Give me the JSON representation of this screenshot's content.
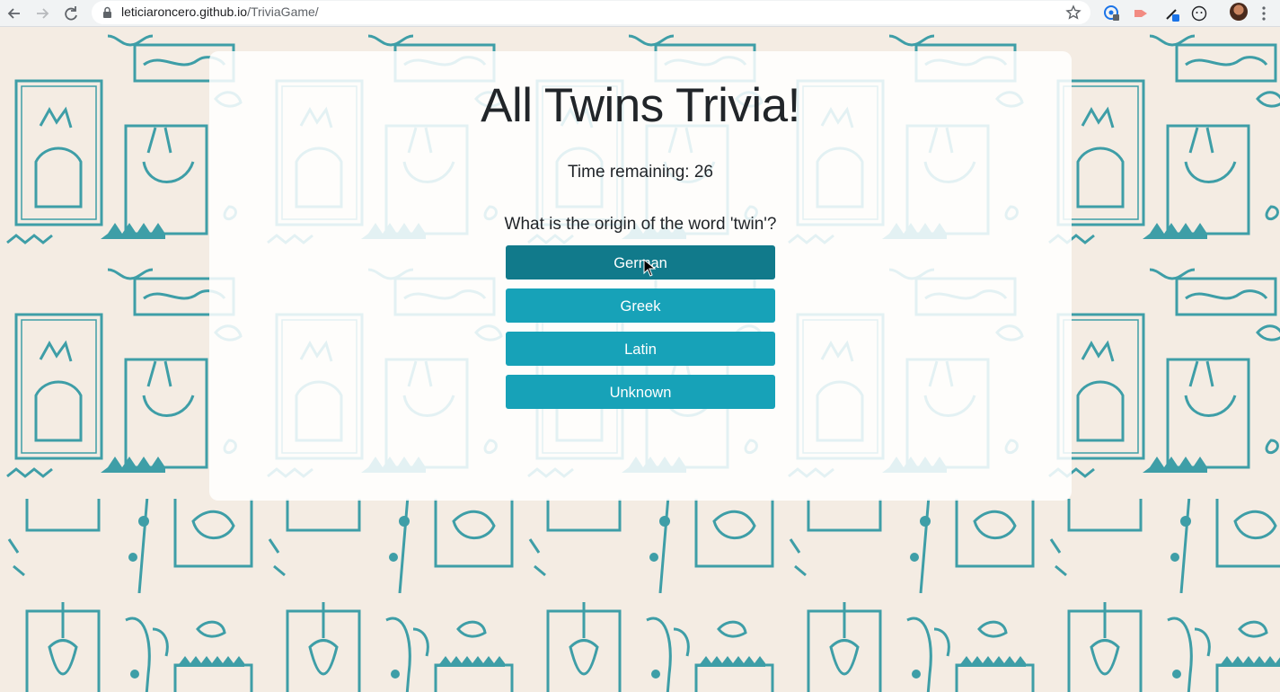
{
  "browser": {
    "url_host": "leticiaroncero.github.io",
    "url_path": "/TriviaGame/",
    "icons": [
      "back-icon",
      "forward-icon",
      "reload-icon",
      "lock-icon",
      "bookmark-star-icon",
      "extension-icon",
      "avatar",
      "menu-icon"
    ]
  },
  "game": {
    "title": "All Twins Trivia!",
    "timer_label": "Time remaining: 26",
    "question": "What is the origin of the word 'twin'?",
    "answers": [
      "German",
      "Greek",
      "Latin",
      "Unknown"
    ],
    "hovered_answer": "German"
  },
  "colors": {
    "button": "#17a2b8",
    "button_hover": "#117a8b",
    "wallpaper_bg": "#f4ece3",
    "wallpaper_line": "#3e9ea7"
  }
}
